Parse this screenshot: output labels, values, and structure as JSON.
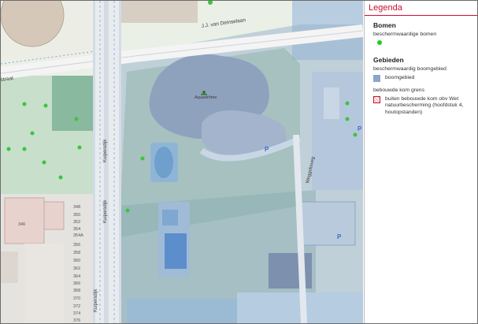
{
  "map": {
    "streets": {
      "deinselaan": "J.J. van Deinselaan",
      "kuipersdijk_1": "Kuipersdijk",
      "kuipersdijk_2": "Kuipersdijk",
      "kuipersdijk_3": "Kuipersdijk",
      "weggeloweg": "Weggeloweg",
      "straat_fragment": "straat"
    },
    "poi": {
      "aquadrome": "Aquadrôme"
    },
    "house_numbers": [
      "348",
      "350",
      "352",
      "354",
      "354A",
      "356",
      "358",
      "360",
      "362",
      "364",
      "366",
      "368",
      "370",
      "372",
      "374",
      "376"
    ],
    "building_number": "346"
  },
  "legend": {
    "title": "Legenda",
    "sections": {
      "bomen": {
        "heading": "Bomen",
        "item": "beschermwaardige bomen",
        "color": "#22cc22"
      },
      "gebieden": {
        "heading": "Gebieden",
        "sub1": "beschermwaardig boomgebied",
        "item1": "boomgebied",
        "item1_color": "#8aa6c8",
        "sub2": "bebouwde kom grens",
        "item2": "buiten bebouwde kom obv Wet natuurbescherming (hoofdstuk 4, houtopstanden)",
        "item2_color": "#c8102e"
      }
    }
  }
}
